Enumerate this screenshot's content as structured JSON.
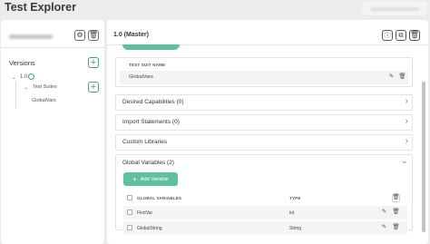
{
  "window": {
    "title": "Test Explorer"
  },
  "sidebar": {
    "versions_label": "Versions",
    "tree": {
      "version": "1.0",
      "suite_folder": "Test Suites",
      "suite_item": "GlobalVars"
    }
  },
  "main": {
    "title": "1.0 (Master)",
    "test_suit_table": {
      "header": "TEST SUIT NAME",
      "rows": [
        "GlobalVars"
      ]
    },
    "sections": {
      "desired_capabilities": "Desired Capabilities (0)",
      "import_statements": "Import Statements (0)",
      "custom_libraries": "Custom Libraries",
      "global_variables": "Global Variables (2)"
    },
    "global_variables": {
      "add_button": "Add Variable",
      "columns": {
        "name": "GLOBAL VARIABLES",
        "type": "TYPE"
      },
      "rows": [
        {
          "name": "FirstVar",
          "type": "int"
        },
        {
          "name": "GlobalString",
          "type": "String"
        }
      ]
    }
  },
  "icons": {
    "gear": "⚙",
    "trash": "🗑",
    "plus": "+",
    "edit": "✎",
    "chevron_right": "›",
    "chevron_down": "⌄"
  },
  "colors": {
    "accent": "#5fbfa0",
    "accent_dark": "#4a9d84",
    "panel_bg": "#ffffff",
    "page_bg": "#ececec"
  }
}
